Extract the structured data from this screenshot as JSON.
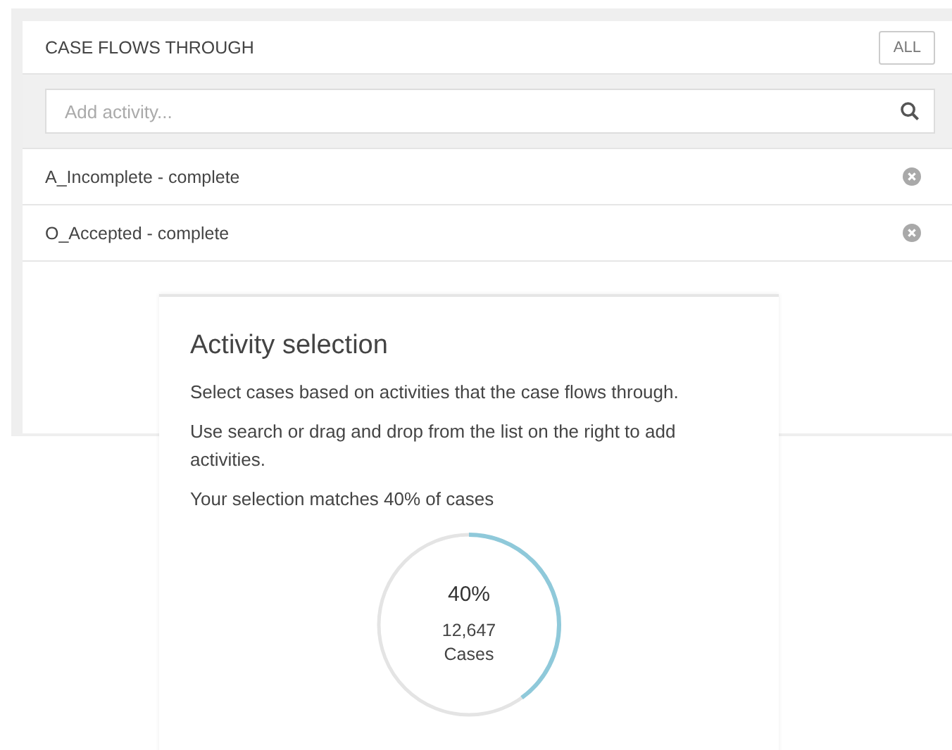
{
  "panel": {
    "title": "CASE FLOWS THROUGH",
    "all_button": "ALL",
    "search": {
      "placeholder": "Add activity..."
    },
    "activities": [
      {
        "label": "A_Incomplete - complete"
      },
      {
        "label": "O_Accepted - complete"
      }
    ]
  },
  "popup": {
    "title": "Activity selection",
    "paragraphs": [
      "Select cases based on activities that the case flows through.",
      "Use search or drag and drop from the list on the right to add activities.",
      "Your selection matches 40% of cases"
    ],
    "gauge": {
      "level": 0.4,
      "percent": "40%",
      "count": "12,647",
      "unit": "Cases"
    }
  }
}
